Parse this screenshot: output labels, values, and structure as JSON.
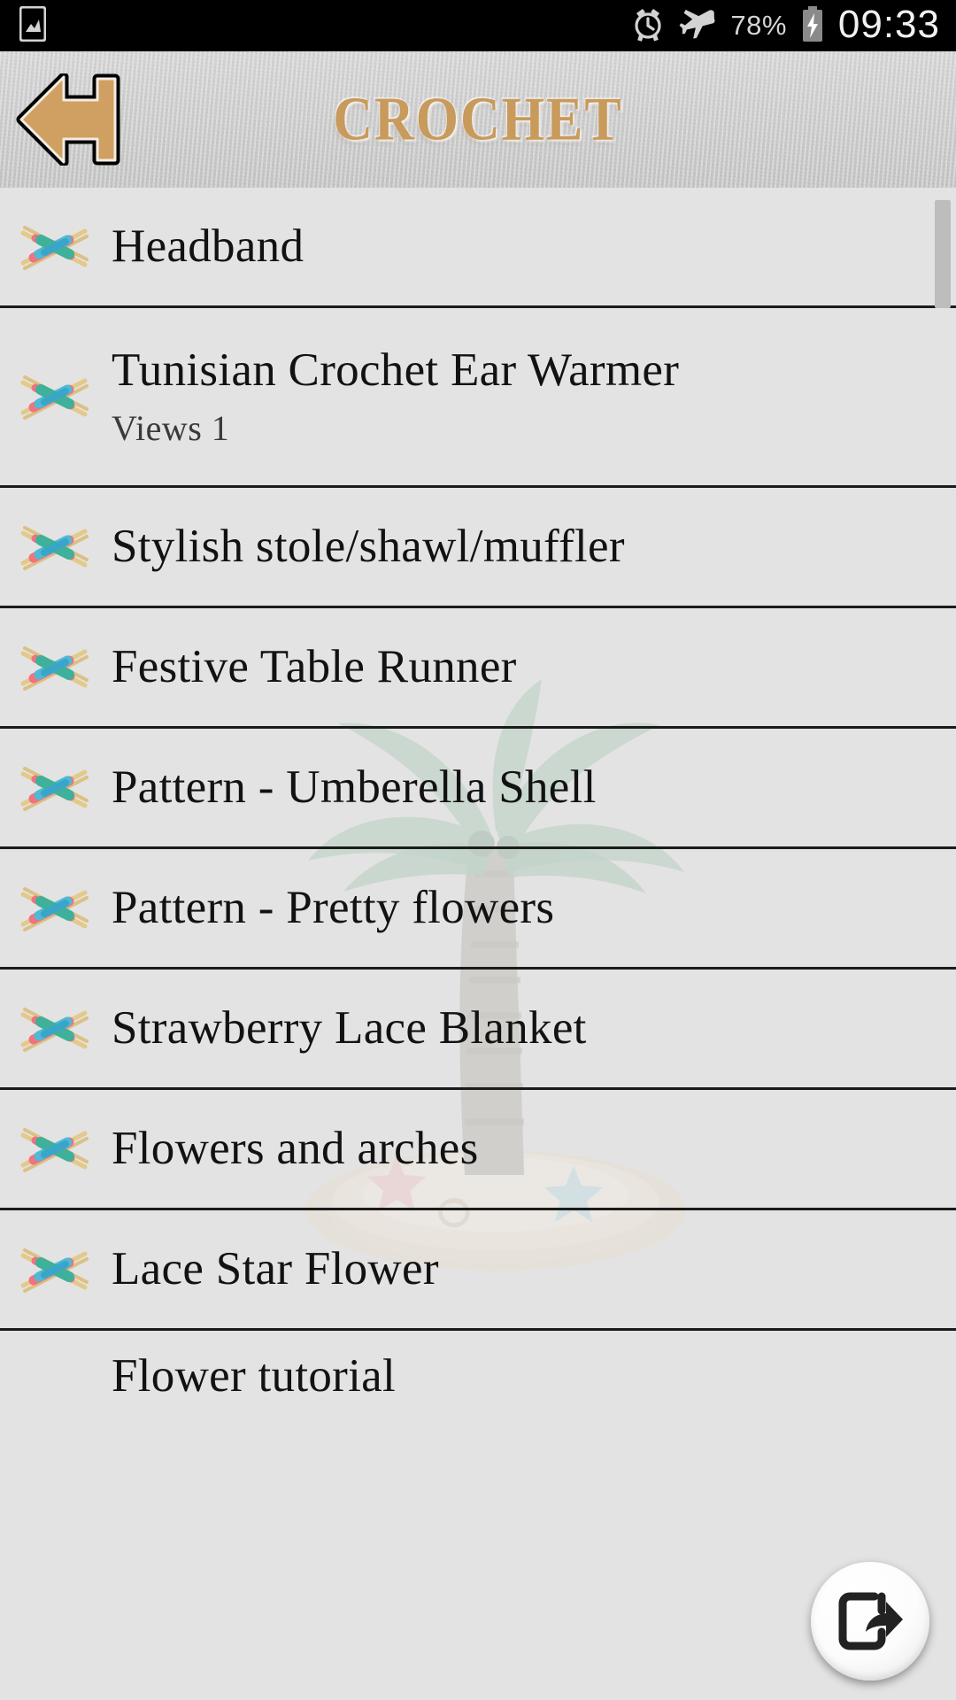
{
  "statusbar": {
    "left_icons": [
      {
        "name": "gallery-icon"
      }
    ],
    "alarm_icon": "alarm-icon",
    "airplane_icon": "airplane-mode-icon",
    "battery_percent": "78%",
    "battery_icon": "battery-charging-icon",
    "clock": "09:33"
  },
  "header": {
    "back_label": "back-arrow",
    "title": "CROCHET",
    "title_color": "#c89a5b"
  },
  "list": {
    "icon_name": "crochet-hooks-icon",
    "items": [
      {
        "title": "Headband",
        "subtitle": ""
      },
      {
        "title": "Tunisian Crochet Ear Warmer",
        "subtitle": "Views 1"
      },
      {
        "title": "Stylish stole/shawl/muffler",
        "subtitle": ""
      },
      {
        "title": "Festive Table Runner",
        "subtitle": ""
      },
      {
        "title": "Pattern - Umberella Shell",
        "subtitle": ""
      },
      {
        "title": "Pattern - Pretty flowers",
        "subtitle": ""
      },
      {
        "title": "Strawberry Lace Blanket",
        "subtitle": ""
      },
      {
        "title": "Flowers and arches",
        "subtitle": ""
      },
      {
        "title": "Lace Star Flower",
        "subtitle": ""
      },
      {
        "title": "Flower tutorial",
        "subtitle": ""
      }
    ]
  },
  "fab": {
    "name": "share-button",
    "icon": "share-exit-icon"
  },
  "scrollbar": {
    "name": "vertical-scrollbar"
  }
}
